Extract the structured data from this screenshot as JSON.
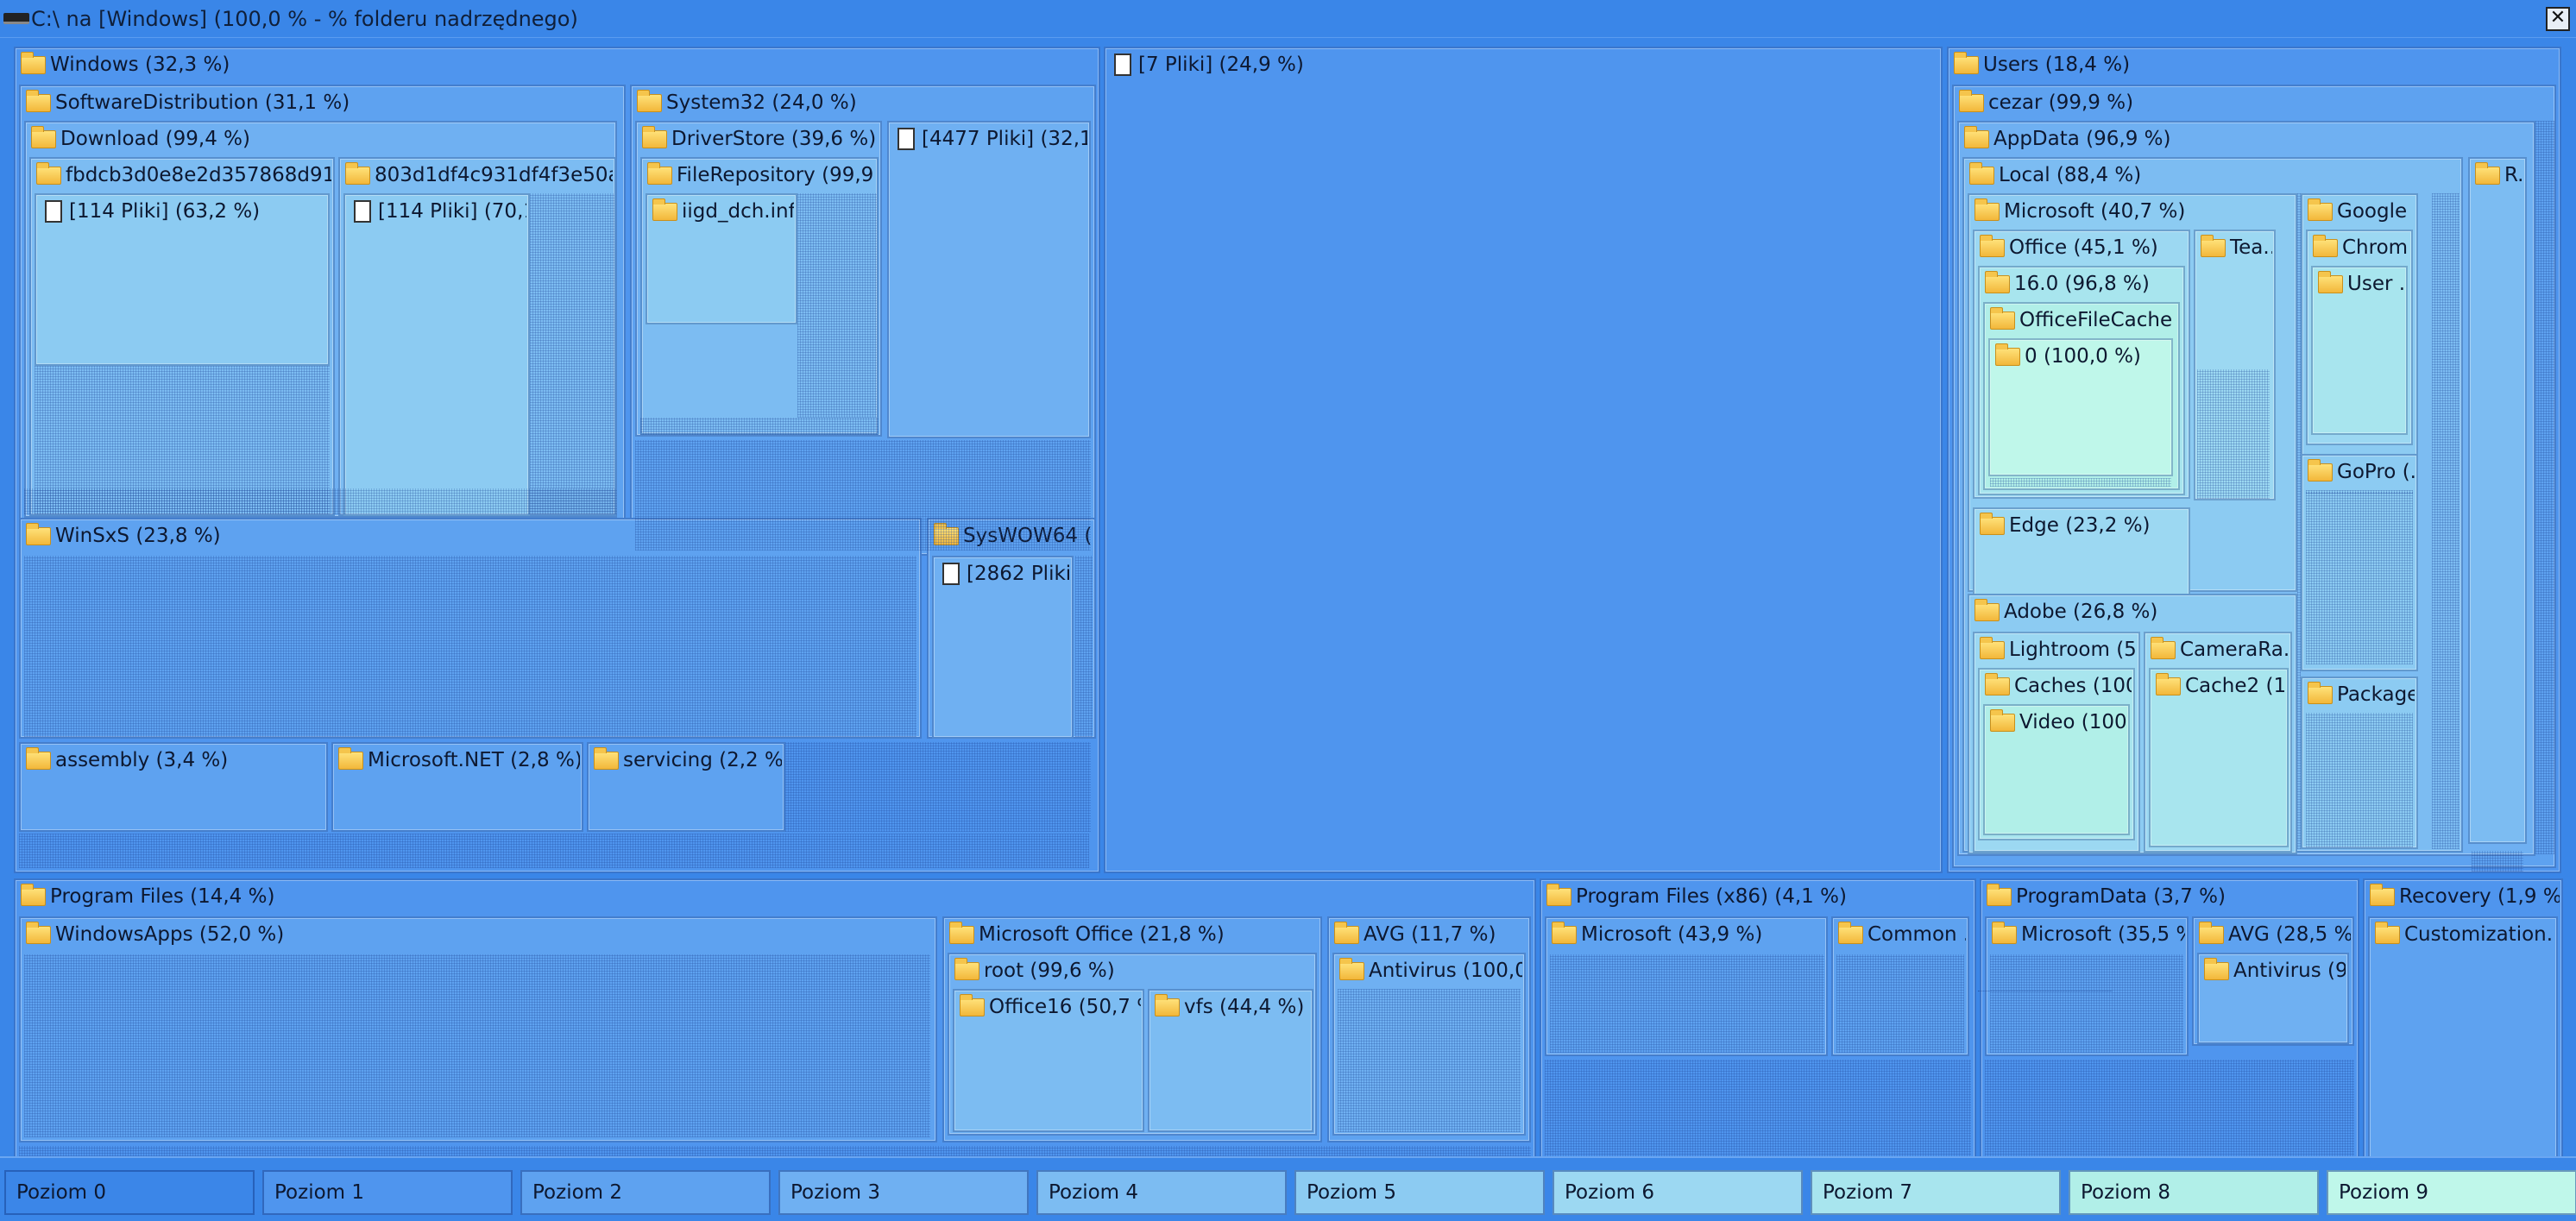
{
  "title": "C:\\  na  [Windows] (100,0 % - % folderu nadrzędnego)",
  "close_glyph": "✕",
  "colors": {
    "level0": "#3b86e8",
    "level1": "#4f95ee",
    "level2": "#5ea2f0",
    "level3": "#6fb0f2",
    "level4": "#7cbcf2",
    "level5": "#8ccbf2",
    "level6": "#9cd8f2",
    "level7": "#a8e5ee",
    "level8": "#b1efe8",
    "level9": "#bff7ea"
  },
  "nodes": {
    "windows": "Windows (32,3 %)",
    "softwaredistribution": "SoftwareDistribution (31,1 %)",
    "download": "Download (99,4 %)",
    "fbdcb": "fbdcb3d0e8e2d357868d910...",
    "fbdcb_files": "[114 Pliki] (63,2 %)",
    "d803": "803d1df4c931df4f3e50a...",
    "d803_files": "[114 Pliki] (70,1...",
    "system32": "System32 (24,0 %)",
    "driverstore": "DriverStore (39,6 %)",
    "filerepository": "FileRepository (99,9 ...",
    "iigd": "iigd_dch.inf...",
    "sys32_files": "[4477 Pliki] (32,1 ...",
    "winsxs": "WinSxS (23,8 %)",
    "syswow64": "SysWOW64 (...",
    "syswow_files": "[2862 Pliki...",
    "assembly": "assembly (3,4 %)",
    "dotnet": "Microsoft.NET (2,8 %)",
    "servicing": "servicing (2,2 %)",
    "root_files": "[7 Pliki] (24,9 %)",
    "users": "Users (18,4 %)",
    "cezar": "cezar (99,9 %)",
    "appdata": "AppData (96,9 %)",
    "local": "Local (88,4 %)",
    "roaming": "R...",
    "local_ms": "Microsoft (40,7 %)",
    "office": "Office (45,1 %)",
    "v16": "16.0 (96,8 %)",
    "officefilecache": "OfficeFileCache ...",
    "zero": "0 (100,0 %)",
    "teams": "Tea...",
    "edge": "Edge (23,2 %)",
    "google": "Google ...",
    "chrome": "Chrom...",
    "user": "User ...",
    "gopro": "GoPro (...",
    "packages": "Package...",
    "adobe": "Adobe (26,8 %)",
    "lightroom": "Lightroom (5...",
    "caches": "Caches (100...",
    "video": "Video (100...",
    "cameraraw": "CameraRa...",
    "cache2": "Cache2 (1...",
    "programfiles": "Program Files (14,4 %)",
    "windowsapps": "WindowsApps (52,0 %)",
    "msoffice": "Microsoft Office (21,8 %)",
    "office_root": "root (99,6 %)",
    "office16": "Office16 (50,7 %)",
    "vfs": "vfs (44,4 %)",
    "avg": "AVG (11,7 %)",
    "antivirus": "Antivirus (100,0 ...",
    "programfilesx86": "Program Files (x86) (4,1 %)",
    "x86_ms": "Microsoft (43,9 %)",
    "common": "Common ...",
    "programdata": "ProgramData (3,7 %)",
    "pd_ms": "Microsoft (35,5 %)",
    "pd_avg": "AVG (28,5 %)",
    "pd_antivirus": "Antivirus (9...",
    "recovery": "Recovery (1,9 %)",
    "customization": "Customization..."
  },
  "legend": [
    "Poziom 0",
    "Poziom 1",
    "Poziom 2",
    "Poziom 3",
    "Poziom 4",
    "Poziom 5",
    "Poziom 6",
    "Poziom 7",
    "Poziom 8",
    "Poziom 9"
  ]
}
